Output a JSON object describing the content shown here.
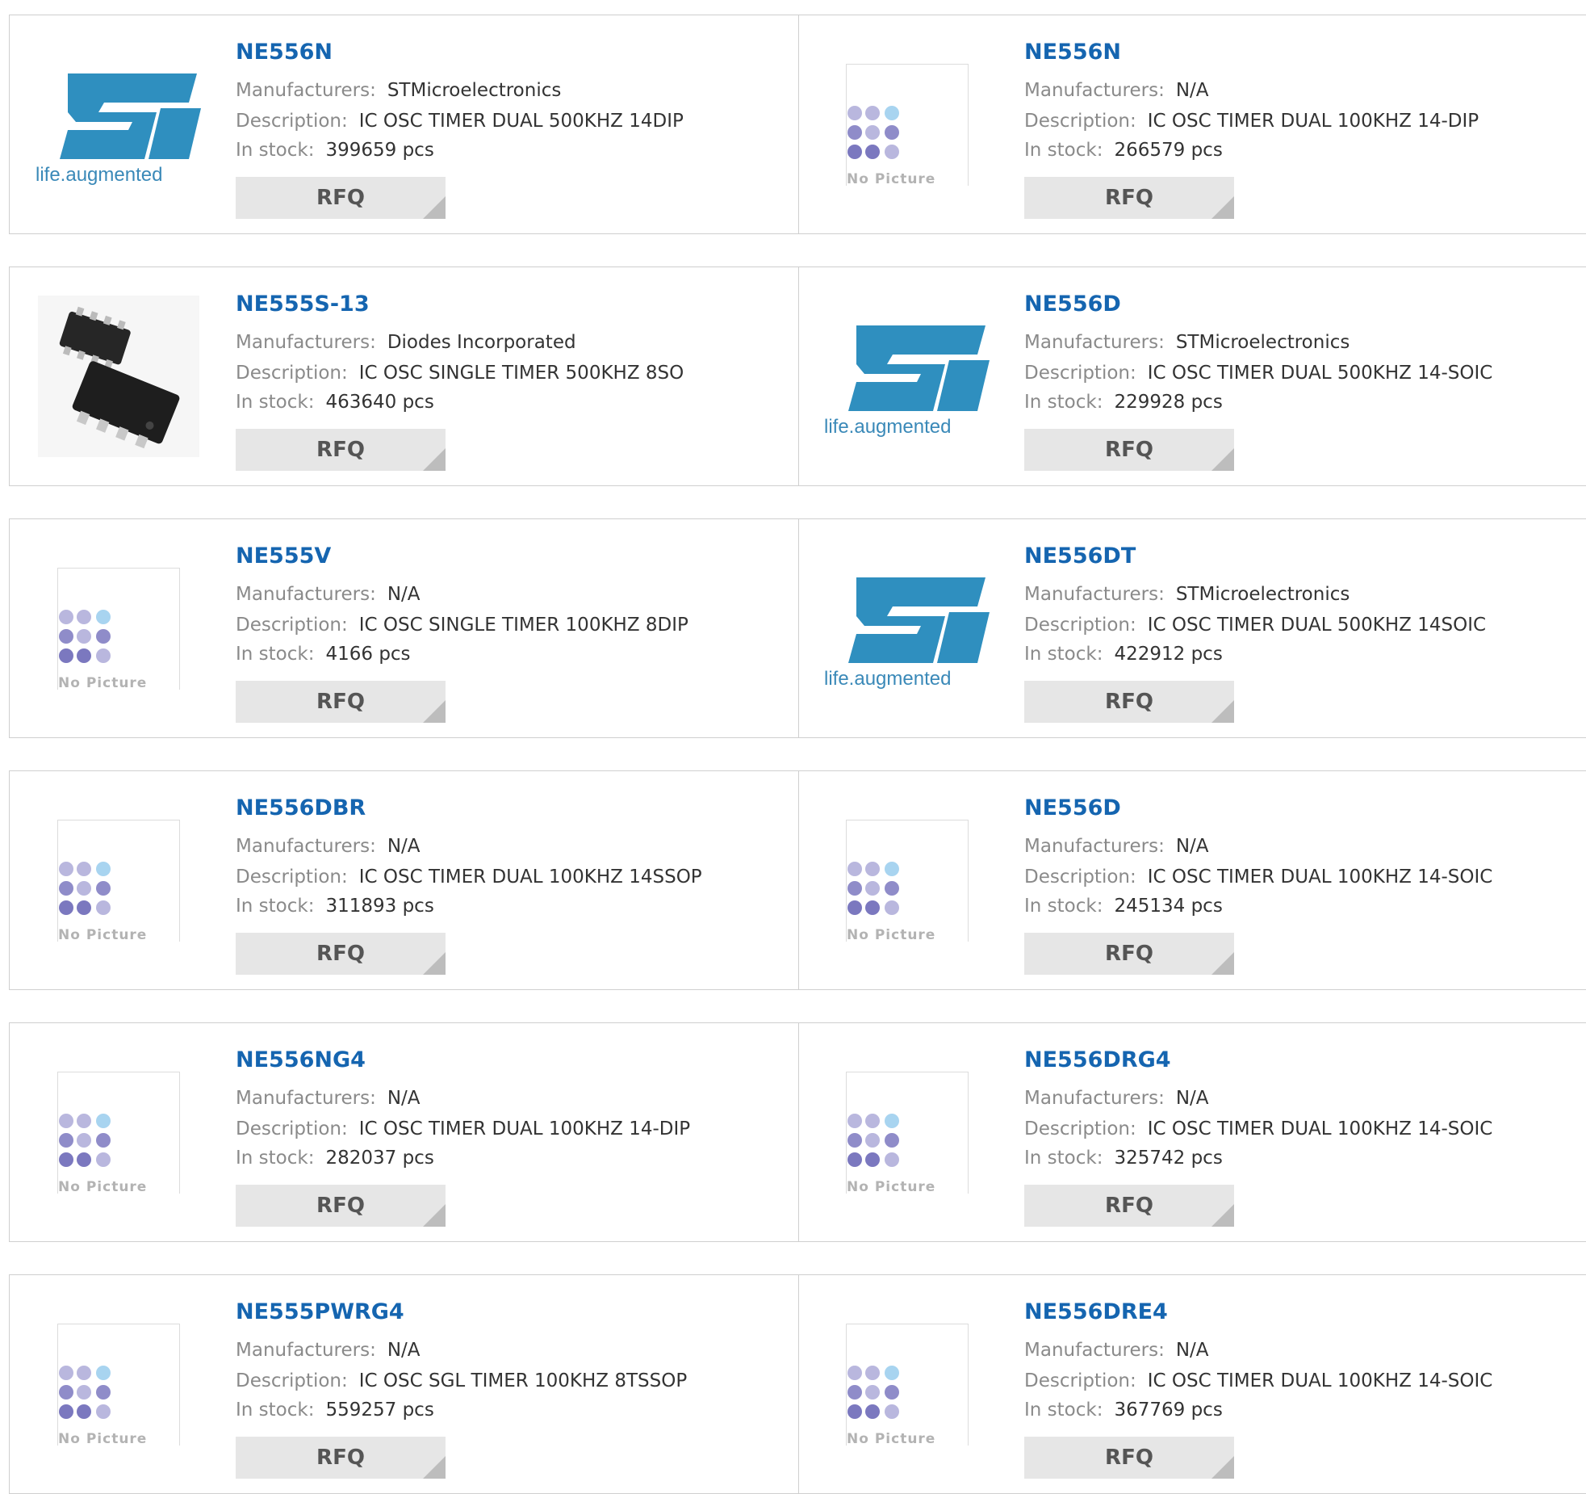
{
  "labels": {
    "manufacturers": "Manufacturers:",
    "description": "Description:",
    "in_stock": "In stock:",
    "rfq": "RFQ",
    "no_picture": "No Picture",
    "st_tagline": "life.augmented"
  },
  "colors": {
    "title_link": "#1565b0",
    "st_blue": "#2f8fbf",
    "rfq_bg": "#e6e6e6",
    "border": "#cfcfcf"
  },
  "products": [
    {
      "part": "NE556N",
      "manufacturer": "STMicroelectronics",
      "description": "IC OSC TIMER DUAL 500KHZ 14DIP",
      "stock": "399659 pcs",
      "image": "st-logo"
    },
    {
      "part": "NE556N",
      "manufacturer": "N/A",
      "description": "IC OSC TIMER DUAL 100KHZ 14-DIP",
      "stock": "266579 pcs",
      "image": "no-picture"
    },
    {
      "part": "NE555S-13",
      "manufacturer": "Diodes Incorporated",
      "description": "IC OSC SINGLE TIMER 500KHZ 8SO",
      "stock": "463640 pcs",
      "image": "chip-photo"
    },
    {
      "part": "NE556D",
      "manufacturer": "STMicroelectronics",
      "description": "IC OSC TIMER DUAL 500KHZ 14-SOIC",
      "stock": "229928 pcs",
      "image": "st-logo"
    },
    {
      "part": "NE555V",
      "manufacturer": "N/A",
      "description": "IC OSC SINGLE TIMER 100KHZ 8DIP",
      "stock": "4166 pcs",
      "image": "no-picture"
    },
    {
      "part": "NE556DT",
      "manufacturer": "STMicroelectronics",
      "description": "IC OSC TIMER DUAL 500KHZ 14SOIC",
      "stock": "422912 pcs",
      "image": "st-logo"
    },
    {
      "part": "NE556DBR",
      "manufacturer": "N/A",
      "description": "IC OSC TIMER DUAL 100KHZ 14SSOP",
      "stock": "311893 pcs",
      "image": "no-picture"
    },
    {
      "part": "NE556D",
      "manufacturer": "N/A",
      "description": "IC OSC TIMER DUAL 100KHZ 14-SOIC",
      "stock": "245134 pcs",
      "image": "no-picture"
    },
    {
      "part": "NE556NG4",
      "manufacturer": "N/A",
      "description": "IC OSC TIMER DUAL 100KHZ 14-DIP",
      "stock": "282037 pcs",
      "image": "no-picture"
    },
    {
      "part": "NE556DRG4",
      "manufacturer": "N/A",
      "description": "IC OSC TIMER DUAL 100KHZ 14-SOIC",
      "stock": "325742 pcs",
      "image": "no-picture"
    },
    {
      "part": "NE555PWRG4",
      "manufacturer": "N/A",
      "description": "IC OSC SGL TIMER 100KHZ 8TSSOP",
      "stock": "559257 pcs",
      "image": "no-picture"
    },
    {
      "part": "NE556DRE4",
      "manufacturer": "N/A",
      "description": "IC OSC TIMER DUAL 100KHZ 14-SOIC",
      "stock": "367769 pcs",
      "image": "no-picture"
    }
  ]
}
